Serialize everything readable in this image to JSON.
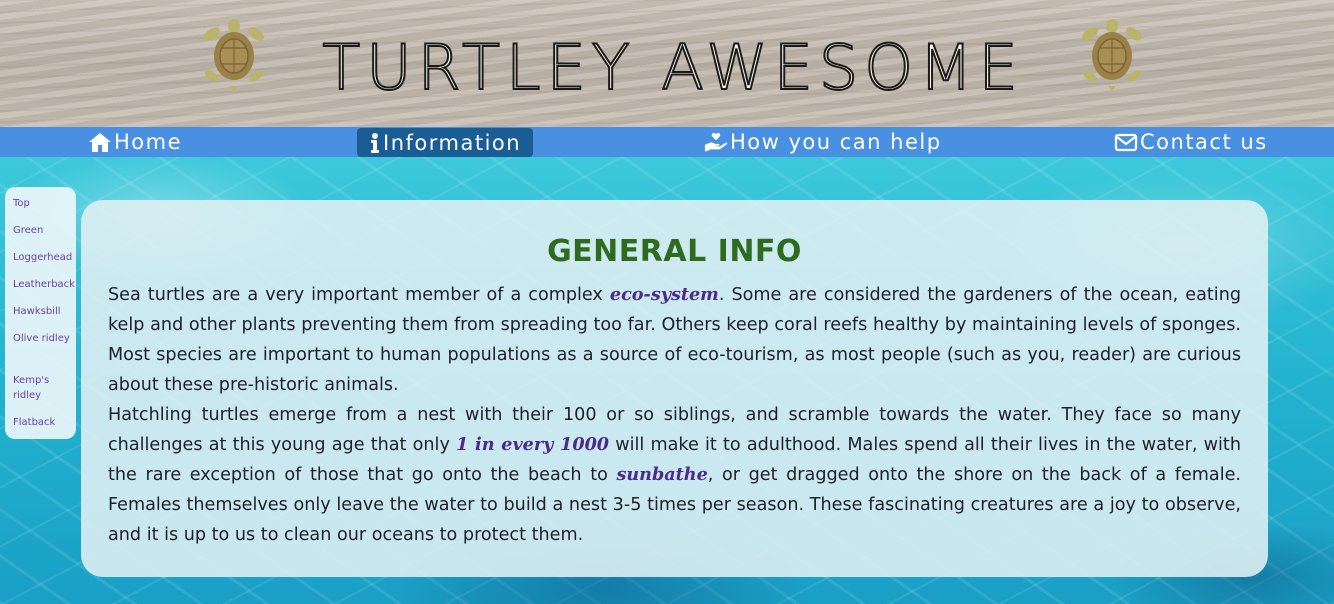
{
  "header": {
    "title": "TURTLEY AWESOME"
  },
  "nav": {
    "items": [
      {
        "label": "Home",
        "icon": "home-icon"
      },
      {
        "label": "Information",
        "icon": "info-icon",
        "active": true
      },
      {
        "label": "How you can help",
        "icon": "helping-hand-icon"
      },
      {
        "label": "Contact us",
        "icon": "envelope-icon"
      }
    ]
  },
  "sidenav": {
    "items": [
      "Top",
      "Green",
      "Loggerhead",
      "Leatherback",
      "Hawksbill",
      "Olive ridley",
      "Kemp's ridley",
      "Flatback"
    ]
  },
  "main": {
    "heading": "GENERAL INFO",
    "p1": {
      "a": "Sea turtles are a very important member of a complex ",
      "b": "eco-system",
      "c": ". Some are considered the gardeners of the ocean, eating kelp and other plants preventing them from spreading too far. Others keep coral reefs healthy by maintaining levels of sponges. Most species are important to human populations as a source of eco-tourism, as most people (such as you, reader) are curious about these pre-historic animals."
    },
    "p2": {
      "a": "Hatchling turtles emerge from a nest with their 100 or so siblings, and scramble towards the water. They face so many challenges at this young age that only ",
      "b": "1 in every 1000",
      "c": " will make it to adulthood. Males spend all their lives in the water, with the rare exception of those that go onto the beach to ",
      "d": "sunbathe",
      "e": ", or get dragged onto the shore on the back of a female. Females themselves only leave the water to build a nest 3-5 times per season. These fascinating creatures are a joy to observe, and it is up to us to clean our oceans to protect them."
    }
  },
  "colors": {
    "nav_bg": "#4a90e2",
    "nav_active": "#1a5c94",
    "heading": "#2e6b1f",
    "highlight": "#4b2a8a",
    "sidenav_link": "#6a3fa8"
  }
}
